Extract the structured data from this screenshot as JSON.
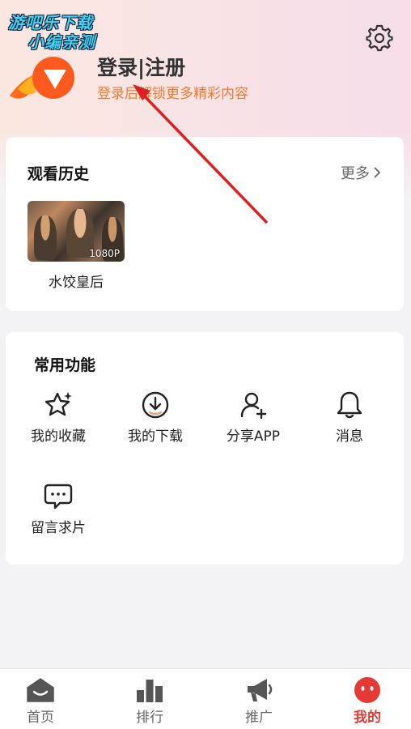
{
  "watermark": {
    "line1": "游吧乐下载",
    "line2": "小编亲测"
  },
  "header": {
    "login_title": "登录|注册",
    "login_subtitle": "登录后解锁更多精彩内容",
    "settings_icon": "gear-icon"
  },
  "history": {
    "title": "观看历史",
    "more_label": "更多",
    "items": [
      {
        "title": "水饺皇后",
        "badge": "1080P"
      }
    ]
  },
  "tools": {
    "title": "常用功能",
    "items": [
      {
        "label": "我的收藏",
        "icon": "star-icon"
      },
      {
        "label": "我的下载",
        "icon": "download-icon"
      },
      {
        "label": "分享APP",
        "icon": "add-user-icon"
      },
      {
        "label": "消息",
        "icon": "bell-icon"
      },
      {
        "label": "留言求片",
        "icon": "message-icon"
      }
    ]
  },
  "tabbar": {
    "items": [
      {
        "label": "首页",
        "icon": "home-icon"
      },
      {
        "label": "排行",
        "icon": "bar-chart-icon"
      },
      {
        "label": "推广",
        "icon": "megaphone-icon"
      },
      {
        "label": "我的",
        "icon": "profile-icon",
        "active": true
      }
    ],
    "active_color": "#e53935"
  },
  "colors": {
    "accent_orange": "#f07a30",
    "arrow_red": "#e02020"
  }
}
